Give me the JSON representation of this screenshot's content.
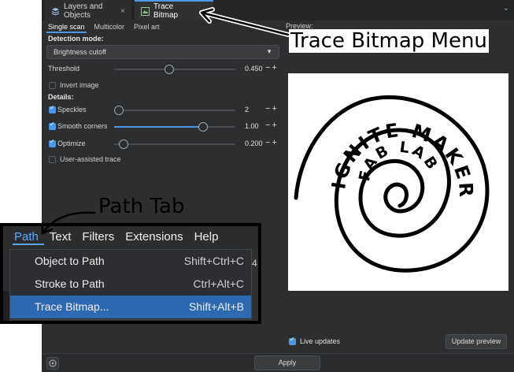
{
  "dialog": {
    "tabs": [
      {
        "label": "Layers and Objects",
        "icon": "layers-icon",
        "active": false
      },
      {
        "label": "Trace Bitmap",
        "icon": "trace-bitmap-icon",
        "active": true
      }
    ],
    "close_glyph": "×",
    "sub_tabs": [
      "Single scan",
      "Multicolor",
      "Pixel art"
    ],
    "detection_mode_label": "Detection mode:",
    "detection_mode_value": "Brightness cutoff",
    "threshold": {
      "label": "Threshold",
      "value": "0.450",
      "fraction": 0.45
    },
    "invert_image": {
      "label": "Invert image",
      "checked": false
    },
    "details_label": "Details:",
    "speckles": {
      "label": "Speckles",
      "value": "2",
      "fraction": 0.0,
      "checked": true
    },
    "smooth_corners": {
      "label": "Smooth corners",
      "value": "1.00",
      "fraction": 0.75,
      "checked": true
    },
    "optimize": {
      "label": "Optimize",
      "value": "0.200",
      "fraction": 0.04,
      "checked": true
    },
    "user_assisted": {
      "label": "User-assisted trace",
      "checked": false
    },
    "preview_label": "Preview:",
    "live_updates": {
      "label": "Live updates",
      "checked": true
    },
    "update_preview_label": "Update preview",
    "apply_label": "Apply",
    "minus_plus": "−+",
    "accent_color": "#4e96e6"
  },
  "preview_text": {
    "outer": "IGNITE MAKER",
    "inner": "FAB LAB"
  },
  "path_menu": {
    "menubar": [
      "Path",
      "Text",
      "Filters",
      "Extensions",
      "Help"
    ],
    "items": [
      {
        "label": "Object to Path",
        "shortcut": "Shift+Ctrl+C",
        "selected": false
      },
      {
        "label": "Stroke to Path",
        "shortcut": "Ctrl+Alt+C",
        "selected": false
      },
      {
        "label": "Trace Bitmap...",
        "shortcut": "Shift+Alt+B",
        "selected": true
      }
    ],
    "underlay_fragment": "4",
    "highlight_color": "#2d69b0"
  },
  "annotations": {
    "trace_bitmap_menu": "Trace Bitmap Menu",
    "path_tab": "Path Tab"
  }
}
